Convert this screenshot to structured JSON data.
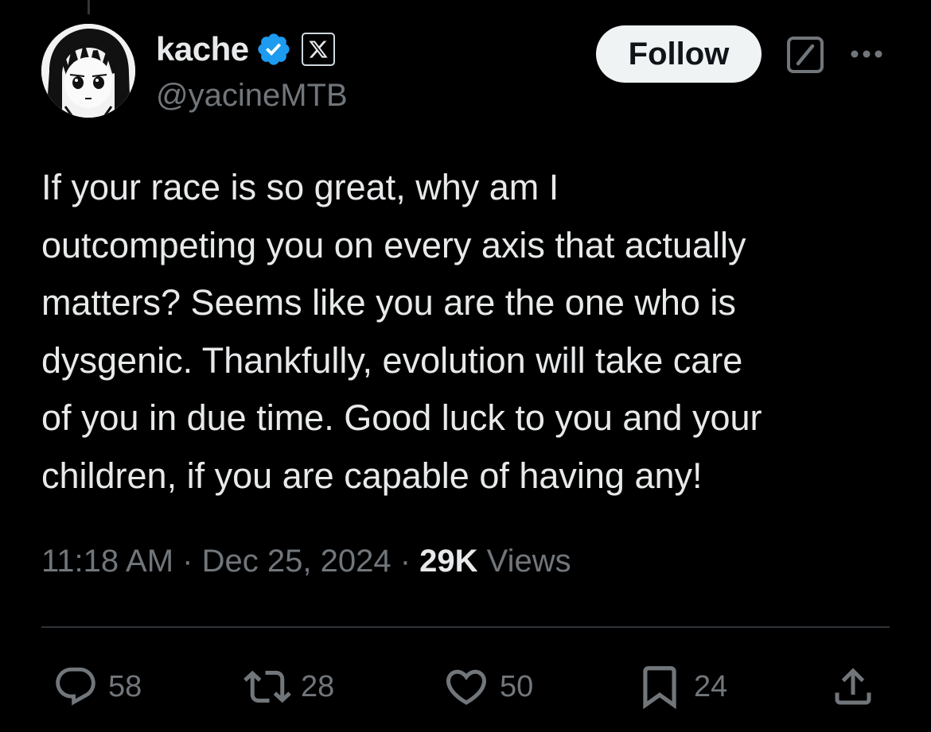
{
  "author": {
    "display_name": "kache",
    "handle": "@yacineMTB",
    "verified_badge_icon": "verified-checkmark-icon",
    "affiliation_badge_icon": "x-logo-icon"
  },
  "header": {
    "follow_label": "Follow",
    "grok_icon": "grok-icon",
    "more_icon": "more-dots-icon"
  },
  "tweet": {
    "text": "If your race is so great, why am I\noutcompeting you on every axis that actually\nmatters? Seems like you are the one who is\ndysgenic. Thankfully, evolution will take care\nof you in due time. Good luck to you and your\nchildren, if you are capable of having any!",
    "time": "11:18 AM",
    "date": "Dec 25, 2024",
    "views_count": "29K",
    "views_label": "Views",
    "separator": "·"
  },
  "actions": {
    "replies": "58",
    "reposts": "28",
    "likes": "50",
    "bookmarks": "24"
  },
  "colors": {
    "background": "#000000",
    "text_primary": "#e7e9ea",
    "text_secondary": "#71767b",
    "verified_blue": "#1d9bf0",
    "divider": "#2f3336"
  }
}
